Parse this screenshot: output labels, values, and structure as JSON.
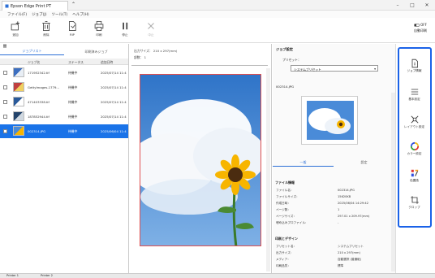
{
  "window": {
    "title": "Epson Edge Print PT",
    "minimize": "–",
    "maximize": "□",
    "close": "✕"
  },
  "menu": [
    "ファイル(F)",
    "ジョブ(J)",
    "ツール(T)",
    "ヘルプ(H)"
  ],
  "toolbar": [
    {
      "label": "追加",
      "icon": "add-icon"
    },
    {
      "label": "削除",
      "icon": "trash-icon"
    },
    {
      "label": "RIP",
      "icon": "rip-icon"
    },
    {
      "label": "印刷",
      "icon": "print-icon"
    },
    {
      "label": "停止",
      "icon": "pause-icon"
    },
    {
      "label": "中止",
      "icon": "cancel-icon"
    }
  ],
  "off_toggle": {
    "state": "OFF",
    "label": "自動印刷"
  },
  "left_tabs": [
    "ジョブリスト",
    "印刷済みジョブ"
  ],
  "file_table": {
    "headers": [
      "ジョブ名",
      "ステータス",
      "追加日時"
    ],
    "rows": [
      {
        "name": "171952342.tif",
        "status": "待機中",
        "date": "2025/07/14 11:4",
        "selected": false
      },
      {
        "name": "GettyImages-1779...",
        "status": "待機中",
        "date": "2025/07/14 11:4",
        "selected": false
      },
      {
        "name": "471403338.tif",
        "status": "待機中",
        "date": "2025/07/14 11:4",
        "selected": false
      },
      {
        "name": "187852944.tif",
        "status": "待機中",
        "date": "2025/07/14 11:4",
        "selected": false
      },
      {
        "name": "002314.JPG",
        "status": "待機中",
        "date": "2025/06/04 11:4",
        "selected": true
      }
    ]
  },
  "center": {
    "output_size": "出力サイズ： 210 x 297(mm)",
    "copies": "部数： 1"
  },
  "right": {
    "title": "ジョブ設定",
    "preset_label": "プリセット：",
    "preset_value": "システムプリセット",
    "filename": "002314.JPG",
    "tabs": [
      "一般",
      "設定"
    ],
    "file_info_title": "ファイル情報",
    "file_info": [
      [
        "ファイル名：",
        "002314.JPG"
      ],
      [
        "ファイルサイズ：",
        "15620KB"
      ],
      [
        "作成日時：",
        "2025/06/04 14:29:42"
      ],
      [
        "ページ数：",
        "1"
      ],
      [
        "ページサイズ：",
        "297.01 x 209.97(mm)"
      ],
      [
        "埋め込みプロファイル：",
        "-"
      ]
    ],
    "print_title": "印刷とデザイン",
    "print_info": [
      [
        "プリセット名：",
        "システムプリセット"
      ],
      [
        "出力サイズ：",
        "210 x 297(mm)"
      ],
      [
        "メディア：",
        "自動選択 (普通紙)"
      ],
      [
        "印刷品質：",
        "標準"
      ]
    ]
  },
  "vertical_tools": [
    {
      "label": "ジョブ情報",
      "icon": "job-info-icon"
    },
    {
      "label": "基本設定",
      "icon": "list-icon"
    },
    {
      "label": "レイアウト設定",
      "icon": "layout-icon"
    },
    {
      "label": "カラー設定",
      "icon": "color-wheel-icon"
    },
    {
      "label": "色置換",
      "icon": "color-replace-icon"
    },
    {
      "label": "クロップ",
      "icon": "crop-icon"
    }
  ],
  "status_tabs": [
    "Printer 1",
    "Printer 2"
  ],
  "colors": {
    "accent": "#1a62e8",
    "selected_row": "#1a73e8",
    "crop_border": "#e05050"
  }
}
